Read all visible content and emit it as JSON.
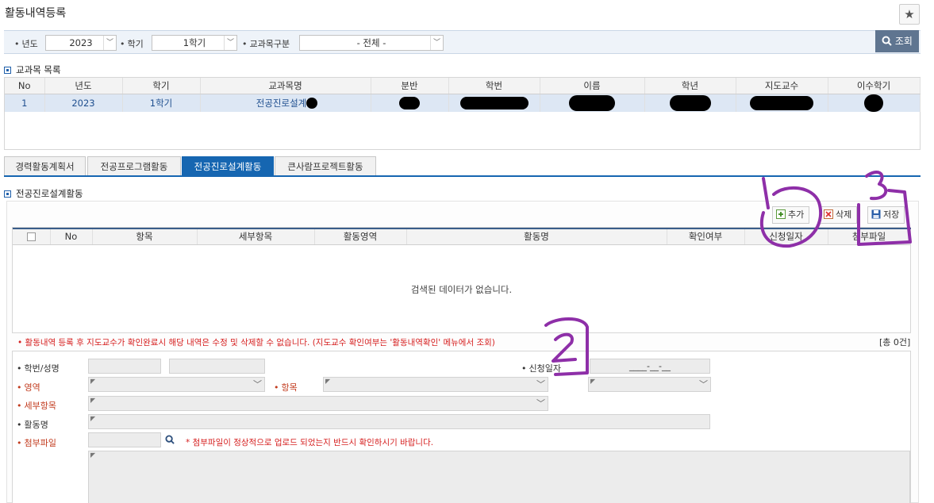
{
  "page": {
    "title": "활동내역등록",
    "star_label": "★"
  },
  "filter": {
    "year_label": "년도",
    "year_value": "2023",
    "term_label": "학기",
    "term_value": "1학기",
    "category_label": "교과목구분",
    "category_value": "- 전체 -",
    "search_label": "조회"
  },
  "course_section": {
    "title": "교과목 목록",
    "columns": [
      "No",
      "년도",
      "학기",
      "교과목명",
      "분반",
      "학번",
      "이름",
      "학년",
      "지도교수",
      "이수학기"
    ],
    "rows": [
      {
        "no": "1",
        "year": "2023",
        "term": "1학기",
        "course": "전공진로설계"
      }
    ]
  },
  "tabs": [
    "경력활동계획서",
    "전공프로그램활동",
    "전공진로설계활동",
    "큰사람프로젝트활동"
  ],
  "activity_section": {
    "title": "전공진로설계활동",
    "add_label": "추가",
    "delete_label": "삭제",
    "save_label": "저장",
    "columns": [
      "No",
      "항목",
      "세부항목",
      "활동영역",
      "활동명",
      "확인여부",
      "신청일자",
      "첨부파일"
    ],
    "empty_message": "검색된 데이터가 없습니다.",
    "notice": "• 활동내역 등록 후 지도교수가 확인완료시 해당 내역은 수정 및 삭제할 수 없습니다. (지도교수 확인여부는 '활동내역확인' 메뉴에서 조회)",
    "total": "[총 0건]"
  },
  "form": {
    "student_label": "학번/성명",
    "date_label": "신청일자",
    "date_value": "____-__-__",
    "area_label": "영역",
    "item_label": "항목",
    "subitem_label": "세부항목",
    "activity_label": "활동명",
    "attach_label": "첨부파일",
    "attach_note": "* 첨부파일이 정상적으로 업로드 되었는지 반드시 확인하시기 바랍니다."
  },
  "annotations": [
    "1",
    "2",
    "3"
  ],
  "colors": {
    "accent": "#1666b1",
    "annotation": "#8e2fa8",
    "required": "#c23b1e",
    "search_button": "#5f7590"
  }
}
